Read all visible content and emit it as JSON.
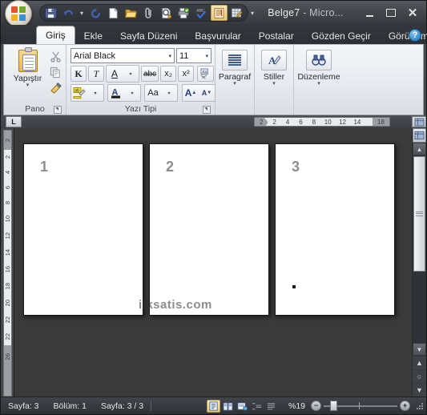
{
  "window": {
    "title_doc": "Belge7",
    "title_sep": " - ",
    "title_app": "Micro...",
    "minimize_label": "",
    "maximize_label": "",
    "close_label": "✕"
  },
  "office_button": {
    "name": "office-orb"
  },
  "quick_access": {
    "items": [
      {
        "name": "save-icon",
        "tooltip": "Kaydet"
      },
      {
        "name": "undo-icon",
        "tooltip": "Geri Al"
      },
      {
        "name": "undo-dropdown-icon",
        "tooltip": ""
      },
      {
        "name": "redo-icon",
        "tooltip": "Yinele"
      },
      {
        "name": "new-document-icon",
        "tooltip": "Yeni"
      },
      {
        "name": "open-folder-icon",
        "tooltip": "Aç"
      },
      {
        "name": "attach-icon",
        "tooltip": "Ekle"
      },
      {
        "name": "print-preview-icon",
        "tooltip": "Baskı Önizleme"
      },
      {
        "name": "quick-print-icon",
        "tooltip": "Hızlı Yazdır"
      },
      {
        "name": "spelling-check-icon",
        "tooltip": "Yazım Denetimi"
      },
      {
        "name": "formatting-marks-icon",
        "tooltip": "Biçimlendirme İşaretleri"
      },
      {
        "name": "draw-table-icon",
        "tooltip": "Tablo Çiz"
      }
    ],
    "dropdown_glyph": "▾"
  },
  "ribbon": {
    "tabs": [
      {
        "label": "Giriş",
        "active": true
      },
      {
        "label": "Ekle",
        "active": false
      },
      {
        "label": "Sayfa Düzeni",
        "active": false
      },
      {
        "label": "Başvurular",
        "active": false
      },
      {
        "label": "Postalar",
        "active": false
      },
      {
        "label": "Gözden Geçir",
        "active": false
      },
      {
        "label": "Görünüm",
        "active": false
      }
    ],
    "help_label": "?",
    "groups": {
      "clipboard": {
        "title": "Pano",
        "paste_label": "Yapıştır",
        "paste_caret": "▾",
        "side_icons": [
          "cut-icon",
          "copy-icon",
          "format-painter-icon"
        ]
      },
      "font": {
        "title": "Yazı Tipi",
        "font_name": "Arial Black",
        "font_size": "11",
        "caret": "▾",
        "buttons": {
          "bold": "K",
          "italic": "T",
          "underline": "A",
          "underline_caret": "▾",
          "strikethrough": "abc",
          "subscript": "x₂",
          "superscript": "x²",
          "clear_formatting": "Aa",
          "highlight": "ab",
          "highlight_caret": "▾",
          "font_color": "A",
          "font_color_caret": "▾",
          "change_case": "Aa",
          "change_case_caret": "▾",
          "grow_font": "A",
          "shrink_font": "A"
        }
      },
      "paragraph": {
        "title": "",
        "label": "Paragraf",
        "caret": "▾"
      },
      "styles": {
        "title": "",
        "label": "Stiller",
        "caret": "▾"
      },
      "editing": {
        "title": "",
        "label": "Düzenleme",
        "caret": "▾"
      }
    }
  },
  "ruler": {
    "tab_stop_glyph": "L",
    "horizontal_ticks": [
      "2",
      "2",
      "4",
      "6",
      "8",
      "10",
      "12",
      "14",
      "18"
    ],
    "vertical_ticks": [
      "2",
      "2",
      "4",
      "6",
      "8",
      "10",
      "12",
      "14",
      "16",
      "18",
      "20",
      "22",
      "22",
      "26"
    ]
  },
  "document": {
    "pages": [
      {
        "number": "1",
        "has_cursor": false
      },
      {
        "number": "2",
        "has_cursor": false
      },
      {
        "number": "3",
        "has_cursor": true
      }
    ],
    "watermark": "ijksatis.com"
  },
  "scrollbar": {
    "up_arrow": "▲",
    "down_arrow": "▼",
    "prev_page": "▲",
    "select_browse_object": "○",
    "next_page": "▼"
  },
  "statusbar": {
    "page_current": "Sayfa: 3",
    "section": "Bölüm: 1",
    "page_of": "Sayfa: 3 / 3",
    "views": [
      {
        "name": "print-layout-view",
        "active": true
      },
      {
        "name": "full-screen-reading-view",
        "active": false
      },
      {
        "name": "web-layout-view",
        "active": false
      },
      {
        "name": "outline-view",
        "active": false
      },
      {
        "name": "draft-view",
        "active": false
      }
    ],
    "zoom_level": "%19",
    "zoom_out_glyph": "−",
    "zoom_in_glyph": "+"
  },
  "colors": {
    "accent_orange": "#e0572a",
    "accent_blue": "#3b8fd1",
    "accent_green": "#74a82b",
    "accent_yellow": "#f0b31a",
    "ribbon_bg": "#e7eaef",
    "chrome_dark": "#3c3f44"
  }
}
